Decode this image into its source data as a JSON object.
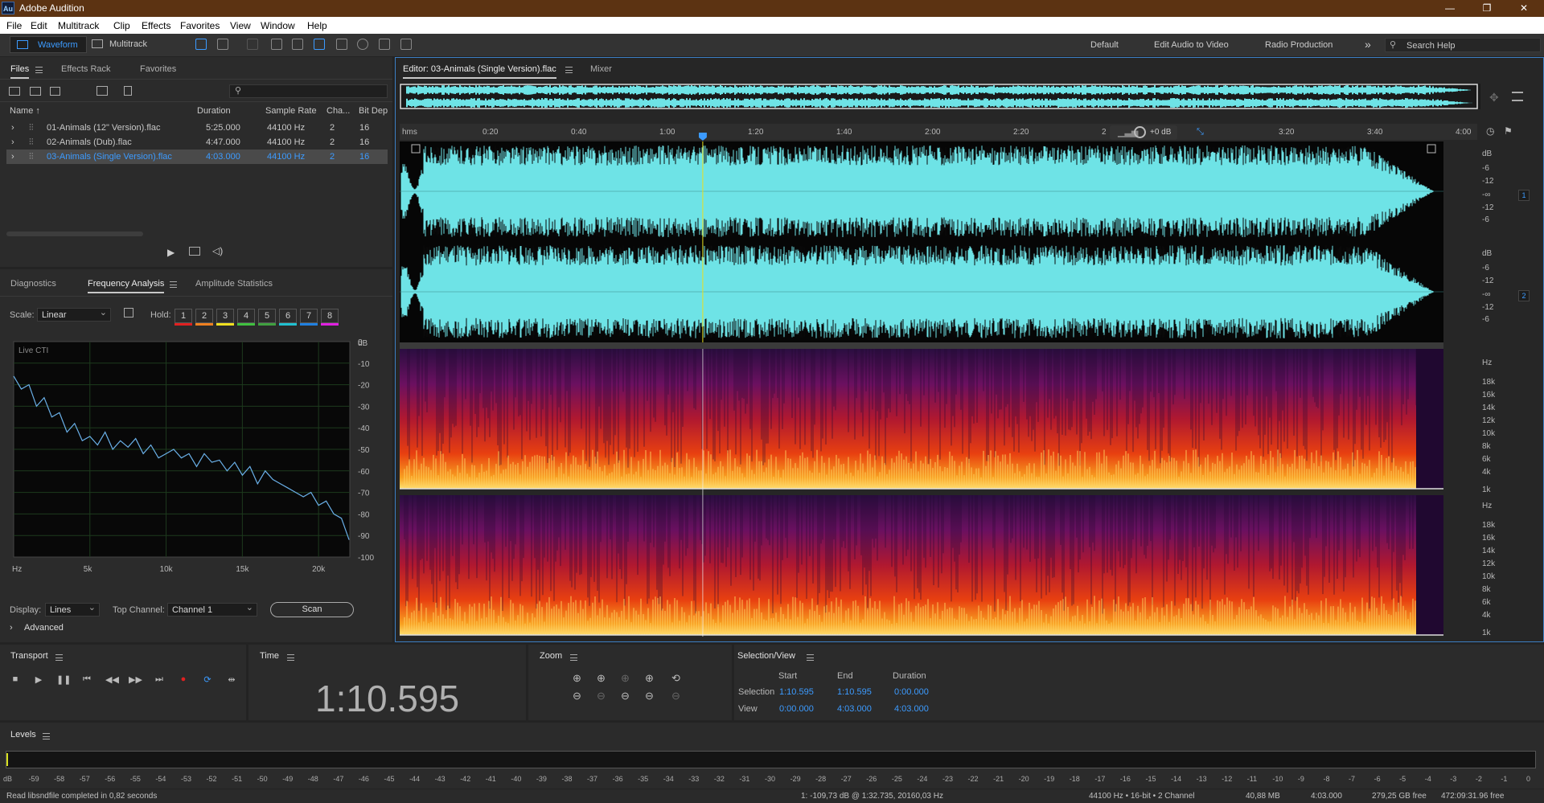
{
  "app": {
    "logo": "Au",
    "title": "Adobe Audition",
    "win_min": "—",
    "win_max": "❐",
    "win_close": "✕"
  },
  "menu": [
    "File",
    "Edit",
    "Multitrack",
    "Clip",
    "Effects",
    "Favorites",
    "View",
    "Window",
    "Help"
  ],
  "toolbar": {
    "waveform": "Waveform",
    "multitrack": "Multitrack",
    "workspaces": [
      "Default",
      "Edit Audio to Video",
      "Radio Production"
    ],
    "more": "»",
    "search_placeholder": "Search Help"
  },
  "files_panel": {
    "tabs": [
      "Files",
      "Effects Rack",
      "Favorites"
    ],
    "columns": [
      "Name ↑",
      "Duration",
      "Sample Rate",
      "Cha...",
      "Bit Dep"
    ],
    "rows": [
      {
        "name": "01-Animals (12\" Version).flac",
        "duration": "5:25.000",
        "rate": "44100 Hz",
        "ch": "2",
        "bit": "16"
      },
      {
        "name": "02-Animals (Dub).flac",
        "duration": "4:47.000",
        "rate": "44100 Hz",
        "ch": "2",
        "bit": "16"
      },
      {
        "name": "03-Animals (Single Version).flac",
        "duration": "4:03.000",
        "rate": "44100 Hz",
        "ch": "2",
        "bit": "16"
      }
    ],
    "selected_row": 2
  },
  "analysis_panel": {
    "tabs": [
      "Diagnostics",
      "Frequency Analysis",
      "Amplitude Statistics"
    ],
    "scale_label": "Scale:",
    "scale_value": "Linear",
    "hold_label": "Hold:",
    "hold_buttons": [
      "1",
      "2",
      "3",
      "4",
      "5",
      "6",
      "7",
      "8"
    ],
    "hold_colors": [
      "#e02020",
      "#f08020",
      "#f0e020",
      "#40c040",
      "#40a040",
      "#20c0d0",
      "#2080e0",
      "#e020e0"
    ],
    "graph_label": "Live CTI",
    "display_label": "Display:",
    "display_value": "Lines",
    "top_channel_label": "Top Channel:",
    "top_channel_value": "Channel 1",
    "scan_label": "Scan",
    "advanced_label": "Advanced"
  },
  "chart_data": {
    "type": "line",
    "title": "Live CTI",
    "xlabel": "Hz",
    "ylabel": "dB",
    "x_ticks": [
      "Hz",
      "5k",
      "10k",
      "15k",
      "20k"
    ],
    "y_ticks": [
      "dB",
      "0",
      "-10",
      "-20",
      "-30",
      "-40",
      "-50",
      "-60",
      "-70",
      "-80",
      "-90",
      "-100"
    ],
    "xlim": [
      0,
      22050
    ],
    "ylim": [
      -100,
      0
    ],
    "line_color": "#6ab0e8",
    "series": [
      {
        "x": [
          0,
          500,
          1000,
          1500,
          2000,
          2500,
          3000,
          3500,
          4000,
          4500,
          5000,
          5500,
          6000,
          6500,
          7000,
          7500,
          8000,
          8500,
          9000,
          9500,
          10000,
          10500,
          11000,
          11500,
          12000,
          12500,
          13000,
          13500,
          14000,
          14500,
          15000,
          15500,
          16000,
          16500,
          17000,
          17500,
          18000,
          18500,
          19000,
          19500,
          20000,
          20500,
          21000,
          21500,
          22000
        ],
        "y": [
          -16,
          -22,
          -20,
          -30,
          -26,
          -35,
          -33,
          -42,
          -38,
          -46,
          -44,
          -48,
          -42,
          -50,
          -46,
          -49,
          -45,
          -52,
          -48,
          -54,
          -52,
          -50,
          -54,
          -52,
          -58,
          -52,
          -56,
          -55,
          -60,
          -56,
          -62,
          -58,
          -66,
          -60,
          -64,
          -66,
          -68,
          -70,
          -72,
          -70,
          -76,
          -74,
          -80,
          -82,
          -92
        ]
      }
    ]
  },
  "editor": {
    "tabs": [
      "Editor: 03-Animals (Single Version).flac",
      "Mixer"
    ],
    "ruler_unit": "hms",
    "ruler_ticks": [
      "0:20",
      "0:40",
      "1:00",
      "1:20",
      "1:40",
      "2:00",
      "2:20",
      "2",
      "3:20",
      "3:40",
      "4:00"
    ],
    "volume": "+0 dB",
    "playhead_fraction": 0.2904,
    "wave_color": "#6ee3e6",
    "amp_labels": [
      "dB",
      "-6",
      "-12",
      "-∞",
      "-12",
      "-6"
    ],
    "channels": [
      "1",
      "2"
    ],
    "spec_labels": [
      "Hz",
      "18k",
      "16k",
      "14k",
      "12k",
      "10k",
      "8k",
      "6k",
      "4k",
      "1k"
    ]
  },
  "transport": {
    "label": "Transport"
  },
  "time": {
    "label": "Time",
    "value": "1:10.595"
  },
  "zoom": {
    "label": "Zoom"
  },
  "selection": {
    "label": "Selection/View",
    "cols": [
      "Start",
      "End",
      "Duration"
    ],
    "rows": [
      {
        "name": "Selection",
        "start": "1:10.595",
        "end": "1:10.595",
        "dur": "0:00.000"
      },
      {
        "name": "View",
        "start": "0:00.000",
        "end": "4:03.000",
        "dur": "4:03.000"
      }
    ]
  },
  "levels": {
    "label": "Levels",
    "ticks": [
      "dB",
      "-59",
      "-58",
      "-57",
      "-56",
      "-55",
      "-54",
      "-53",
      "-52",
      "-51",
      "-50",
      "-49",
      "-48",
      "-47",
      "-46",
      "-45",
      "-44",
      "-43",
      "-42",
      "-41",
      "-40",
      "-39",
      "-38",
      "-37",
      "-36",
      "-35",
      "-34",
      "-33",
      "-32",
      "-31",
      "-30",
      "-29",
      "-28",
      "-27",
      "-26",
      "-25",
      "-24",
      "-23",
      "-22",
      "-21",
      "-20",
      "-19",
      "-18",
      "-17",
      "-16",
      "-15",
      "-14",
      "-13",
      "-12",
      "-11",
      "-10",
      "-9",
      "-8",
      "-7",
      "-6",
      "-5",
      "-4",
      "-3",
      "-2",
      "-1",
      "0"
    ]
  },
  "status": {
    "left": "Read libsndfile completed in 0,82 seconds",
    "cursor": "1: -109,73 dB @ 1:32.735, 20160,03 Hz",
    "format": "44100 Hz • 16-bit • 2 Channel",
    "size": "40,88 MB",
    "duration": "4:03.000",
    "free": "279,25 GB free",
    "free_time": "472:09:31.96 free"
  }
}
